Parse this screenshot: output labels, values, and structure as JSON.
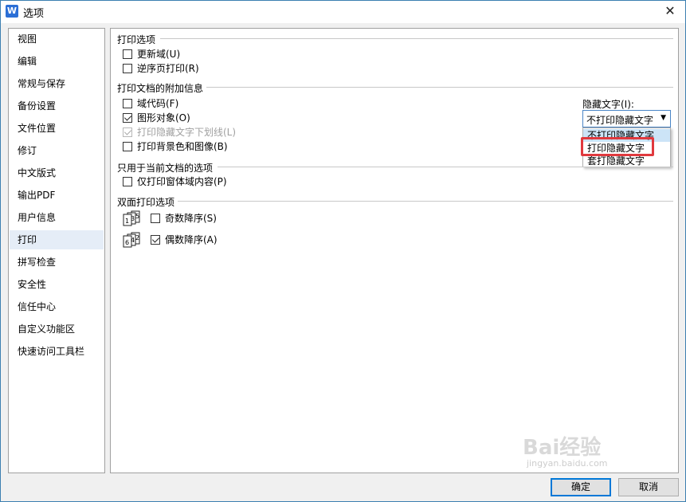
{
  "window": {
    "title": "选项",
    "app_icon": "W",
    "close_glyph": "✕"
  },
  "sidebar": {
    "items": [
      {
        "label": "视图"
      },
      {
        "label": "编辑"
      },
      {
        "label": "常规与保存"
      },
      {
        "label": "备份设置"
      },
      {
        "label": "文件位置"
      },
      {
        "label": "修订"
      },
      {
        "label": "中文版式"
      },
      {
        "label": "输出PDF"
      },
      {
        "label": "用户信息"
      },
      {
        "label": "打印",
        "active": true
      },
      {
        "label": "拼写检查"
      },
      {
        "label": "安全性"
      },
      {
        "label": "信任中心"
      },
      {
        "label": "自定义功能区"
      },
      {
        "label": "快速访问工具栏"
      }
    ]
  },
  "print_options": {
    "title": "打印选项",
    "update_fields": {
      "label": "更新域(U)",
      "checked": false
    },
    "reverse_print": {
      "label": "逆序页打印(R)",
      "checked": false
    }
  },
  "extra_info": {
    "title": "打印文档的附加信息",
    "field_codes": {
      "label": "域代码(F)",
      "checked": false
    },
    "drawing_objects": {
      "label": "图形对象(O)",
      "checked": true
    },
    "hidden_underline": {
      "label": "打印隐藏文字下划线(L)",
      "checked": true,
      "disabled": true
    },
    "background": {
      "label": "打印背景色和图像(B)",
      "checked": false
    },
    "hidden_text_label": "隐藏文字(I):",
    "hidden_text_value": "不打印隐藏文字",
    "hidden_text_options": [
      "不打印隐藏文字",
      "打印隐藏文字",
      "套打隐藏文字"
    ]
  },
  "current_doc": {
    "title": "只用于当前文档的选项",
    "form_data_only": {
      "label": "仅打印窗体域内容(P)",
      "checked": false
    }
  },
  "duplex": {
    "title": "双面打印选项",
    "odd": {
      "label": "奇数降序(S)",
      "checked": false,
      "icon_digits": "1 3 5"
    },
    "even": {
      "label": "偶数降序(A)",
      "checked": true,
      "icon_digits": "6 4 2"
    }
  },
  "buttons": {
    "ok": "确定",
    "cancel": "取消"
  },
  "watermark": {
    "text": "Bai经验",
    "sub": "jingyan.baidu.com"
  },
  "colors": {
    "accent": "#0078d7",
    "highlight": "#e0393e",
    "hover": "#cce4f7"
  }
}
